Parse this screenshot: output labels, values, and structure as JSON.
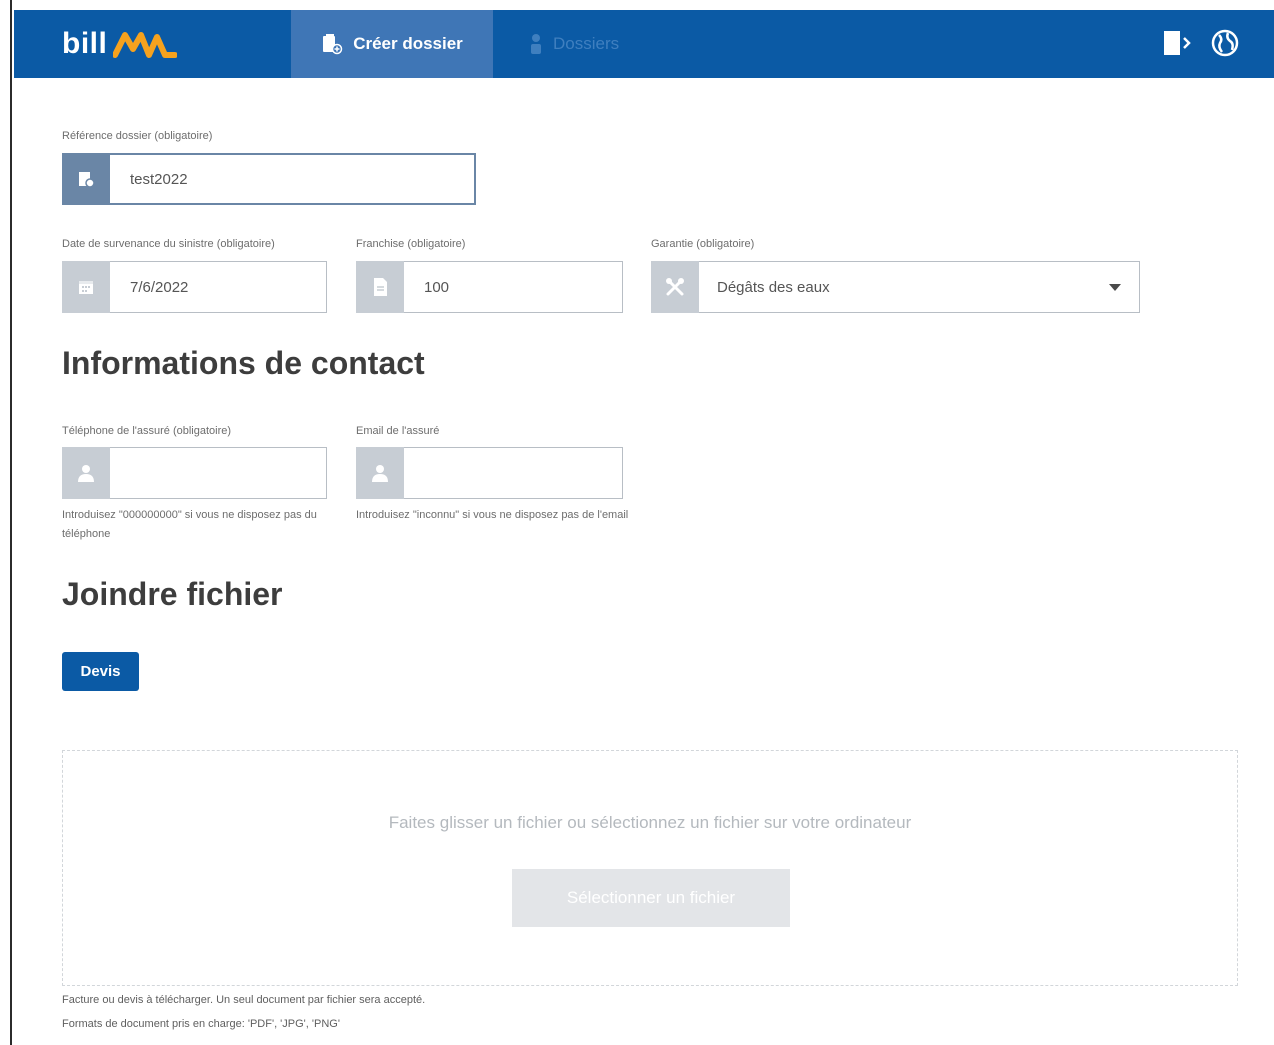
{
  "header": {
    "brand_text": "bill",
    "brand_mark": "MA",
    "active_tab_label": "Créer dossier",
    "inactive_tab_label": "Dossiers",
    "icons": [
      "logout-icon",
      "globe-icon"
    ]
  },
  "form": {
    "reference": {
      "label": "Référence dossier (obligatoire)",
      "value": "test2022",
      "icon": "folder-icon"
    },
    "date": {
      "label": "Date de survenance du sinistre (obligatoire)",
      "value": "7/6/2022",
      "icon": "calendar-icon"
    },
    "franchise": {
      "label": "Franchise (obligatoire)",
      "value": "100",
      "icon": "document-icon"
    },
    "garantie": {
      "label": "Garantie (obligatoire)",
      "value": "Dégâts des eaux",
      "icon": "tools-icon"
    }
  },
  "contact": {
    "heading": "Informations de contact",
    "phone": {
      "label": "Téléphone de l'assuré (obligatoire)",
      "value": "",
      "help": "Introduisez \"000000000\" si vous ne disposez pas du téléphone",
      "icon": "user-icon"
    },
    "email": {
      "label": "Email de l'assuré",
      "value": "",
      "help": "Introduisez \"inconnu\" si vous ne disposez pas de l'email",
      "icon": "user-icon"
    }
  },
  "attach": {
    "heading": "Joindre fichier",
    "devis_label": "Devis",
    "drop_text": "Faites glisser un fichier ou sélectionnez un fichier sur votre ordinateur",
    "select_label": "Sélectionner un fichier",
    "note_1": "Facture ou devis à télécharger. Un seul document par fichier sera accepté.",
    "note_2": "Formats de document pris en charge: 'PDF', 'JPG', 'PNG'"
  },
  "colors": {
    "brand_blue": "#0b5aa5",
    "active_tab": "#3f76b6",
    "accent_orange": "#f6a21e"
  }
}
